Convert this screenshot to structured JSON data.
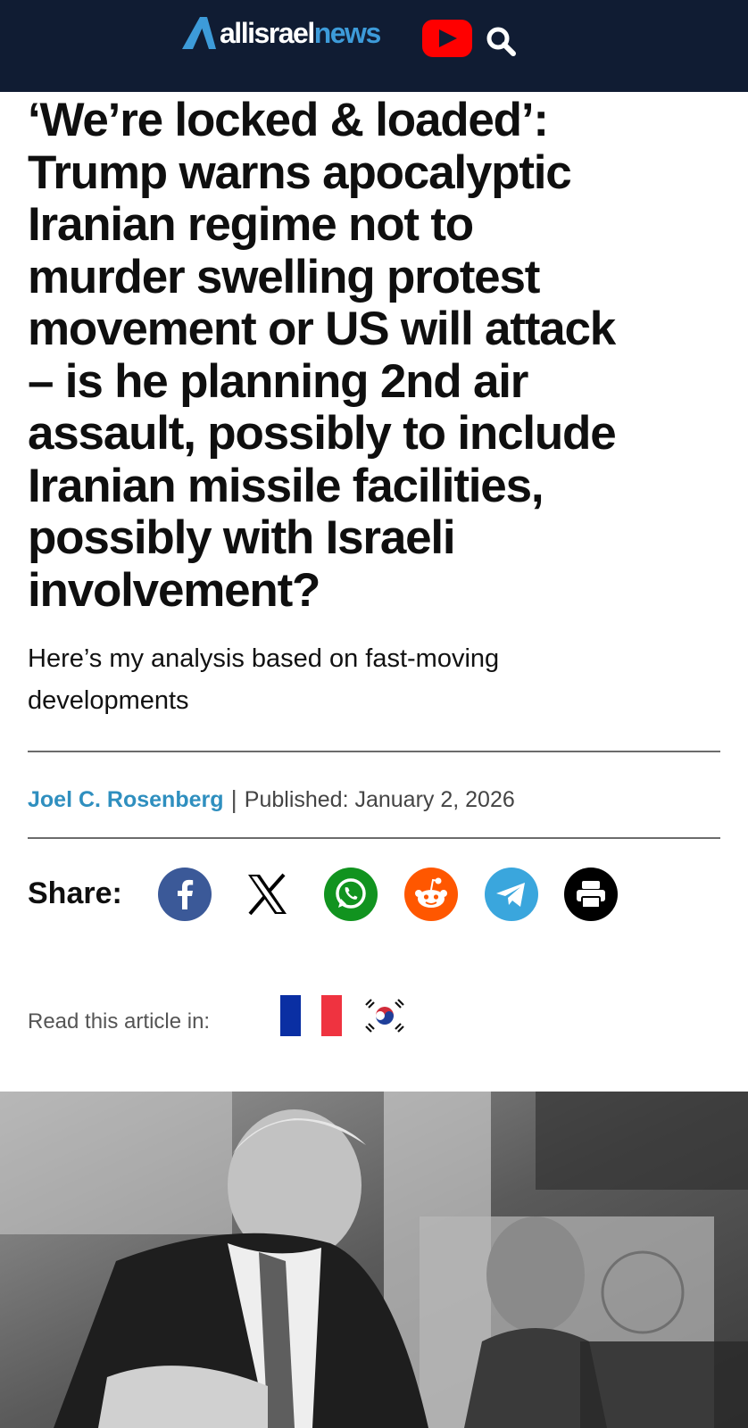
{
  "header": {
    "logo_part1": "allisrael",
    "logo_part2": "news",
    "youtube_icon": "youtube-play-icon",
    "search_icon": "magnifier-icon",
    "colors": {
      "bar": "#101c33",
      "logo_accent": "#3d9bd9",
      "youtube": "#ff0000"
    }
  },
  "article": {
    "headline_lines": [
      "‘We’re locked & loaded’:",
      "Trump warns apocalyptic",
      "Iranian regime not to",
      "murder swelling protest",
      "movement or US will attack",
      "– is he planning 2nd air",
      "assault, possibly to include",
      "Iranian missile facilities,",
      "possibly with Israeli",
      "involvement?"
    ],
    "subhead_lines": [
      "Here’s my analysis based on fast-moving",
      "developments"
    ],
    "author": "Joel C. Rosenberg",
    "separator": "|",
    "published": "Published: January 2, 2026"
  },
  "share": {
    "label": "Share:",
    "buttons": [
      {
        "icon": "facebook-icon",
        "color": "#3b5998"
      },
      {
        "icon": "x-icon",
        "color": "#000000"
      },
      {
        "icon": "whatsapp-icon",
        "color": "#11931f"
      },
      {
        "icon": "reddit-icon",
        "color": "#ff5700"
      },
      {
        "icon": "telegram-icon",
        "color": "#3aa6dd"
      },
      {
        "icon": "print-icon",
        "color": "#000000"
      }
    ]
  },
  "translations": {
    "label": "Read this article in:",
    "flags": [
      "france-flag-icon",
      "south-korea-flag-icon"
    ]
  },
  "hero_image": {
    "subject": "black-and-white-photo-icon"
  }
}
